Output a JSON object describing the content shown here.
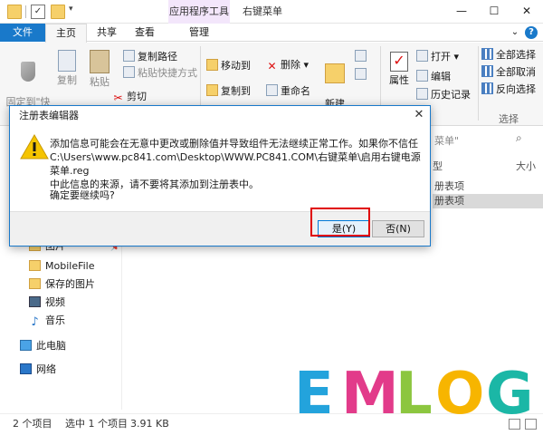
{
  "titlebar": {
    "context_tab": "应用程序工具",
    "window_title": "右键菜单",
    "minimize": "—",
    "maximize": "☐",
    "close": "✕"
  },
  "tabs": {
    "file": "文件",
    "home": "主页",
    "share": "共享",
    "view": "查看",
    "manage": "管理",
    "collapse": "⌄",
    "help": "?"
  },
  "ribbon": {
    "pin_label": "固定到\"快\n速访问\"",
    "copy": "复制",
    "paste": "粘贴",
    "copy_path": "复制路径",
    "paste_shortcut": "粘贴快捷方式",
    "cut": "剪切",
    "move_to": "移动到",
    "copy_to": "复制到",
    "delete": "删除",
    "rename": "重命名",
    "new_folder": "新建\n文件夹",
    "properties": "属性",
    "open": "打开",
    "edit": "编辑",
    "history": "历史记录",
    "select_all": "全部选择",
    "select_none": "全部取消",
    "invert_selection": "反向选择",
    "select_group": "选择"
  },
  "explorer": {
    "search_hint": "菜单\"",
    "col_type": "型",
    "col_size": "大小",
    "row1": "册表项",
    "row2": "册表项"
  },
  "nav": {
    "pictures": "图片",
    "mobilefile": "MobileFile",
    "saved_pictures": "保存的图片",
    "videos": "视频",
    "music": "音乐",
    "this_pc": "此电脑",
    "network": "网络"
  },
  "status": {
    "count": "2 个项目",
    "selected": "选中 1 个项目",
    "size": "3.91 KB"
  },
  "logo": {
    "letters": [
      "E",
      "M",
      "L",
      "O",
      "G"
    ],
    "colors": [
      "#23a3dc",
      "#e23b8a",
      "#8cc63f",
      "#f7b500",
      "#1bb7a6"
    ]
  },
  "dialog": {
    "title": "注册表编辑器",
    "close": "✕",
    "message": "添加信息可能会在无意中更改或删除值并导致组件无法继续正常工作。如果你不信任\nC:\\Users\\www.pc841.com\\Desktop\\WWW.PC841.COM\\右键菜单\\启用右键电源菜单.reg\n中此信息的来源，请不要将其添加到注册表中。",
    "confirm": "确定要继续吗?",
    "yes": "是(Y)",
    "no": "否(N)"
  },
  "colors": {
    "accent": "#1979ca",
    "context_tab_bg": "#f3e6fb",
    "highlight_red": "#e00000"
  }
}
